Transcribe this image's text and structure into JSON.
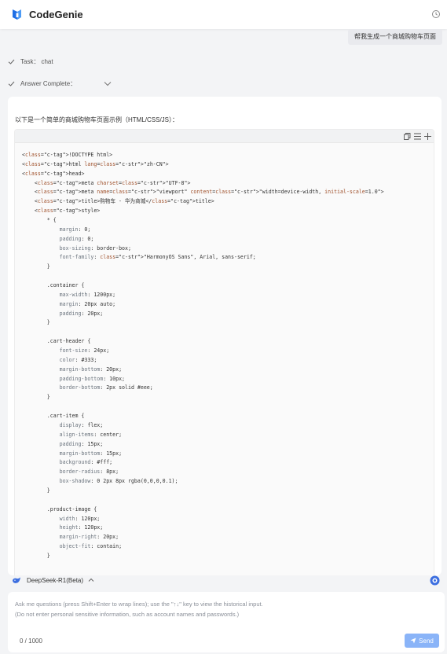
{
  "header": {
    "title": "CodeGenie",
    "logo_icon": "codegenie-logo",
    "history_icon": "history-icon"
  },
  "conversation": {
    "user_message": "帮我生成一个商城购物车页面",
    "task_label": "Task：",
    "task_value": "chat",
    "answer_status": "Answer Complete："
  },
  "answer": {
    "intro": "以下是一个简单的商城购物车页面示例（HTML/CSS/JS）：",
    "code_lines": [
      "<!DOCTYPE html>",
      "<html lang=\"zh-CN\">",
      "<head>",
      "    <meta charset=\"UTF-8\">",
      "    <meta name=\"viewport\" content=\"width=device-width, initial-scale=1.0\">",
      "    <title>购物车 - 华为商城</title>",
      "    <style>",
      "        * {",
      "            margin: 0;",
      "            padding: 0;",
      "            box-sizing: border-box;",
      "            font-family: \"HarmonyOS Sans\", Arial, sans-serif;",
      "        }",
      "",
      "        .container {",
      "            max-width: 1200px;",
      "            margin: 20px auto;",
      "            padding: 20px;",
      "        }",
      "",
      "        .cart-header {",
      "            font-size: 24px;",
      "            color: #333;",
      "            margin-bottom: 20px;",
      "            padding-bottom: 10px;",
      "            border-bottom: 2px solid #eee;",
      "        }",
      "",
      "        .cart-item {",
      "            display: flex;",
      "            align-items: center;",
      "            padding: 15px;",
      "            margin-bottom: 15px;",
      "            background: #fff;",
      "            border-radius: 8px;",
      "            box-shadow: 0 2px 8px rgba(0,0,0,0.1);",
      "        }",
      "",
      "        .product-image {",
      "            width: 120px;",
      "            height: 120px;",
      "            margin-right: 20px;",
      "            object-fit: contain;",
      "        }"
    ]
  },
  "model": {
    "name": "DeepSeek-R1(Beta)"
  },
  "input": {
    "placeholder_line1": "Ask me questions (press Shift+Enter to wrap lines); use the \"↑↓\" key to view the historical input.",
    "placeholder_line2": "(Do not enter personal sensitive information, such as account names and passwords.)",
    "counter": "0 / 1000",
    "send_label": "Send"
  },
  "colors": {
    "accent": "#1f6fe5",
    "send_button": "#8ab4f8",
    "background": "#f3f4f6"
  }
}
